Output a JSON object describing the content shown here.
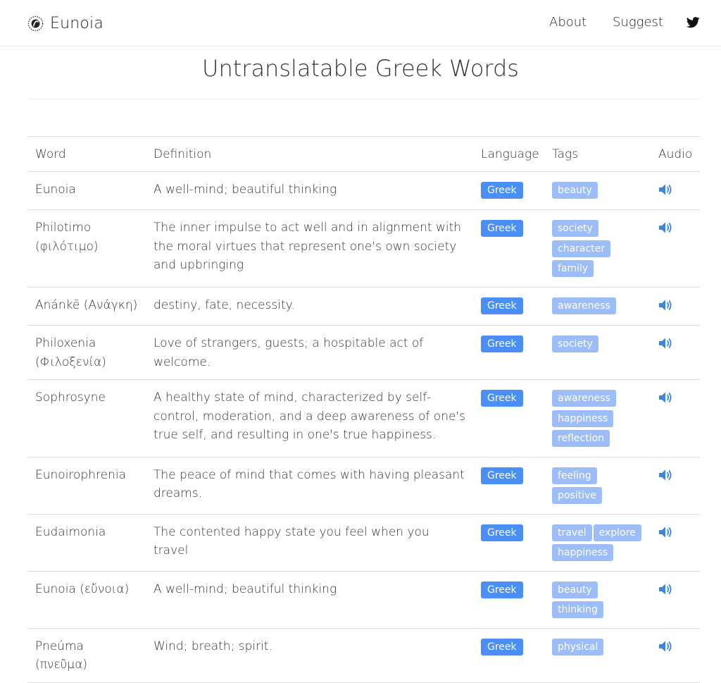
{
  "brand": {
    "name": "Eunoia"
  },
  "nav": {
    "about": "About",
    "suggest": "Suggest"
  },
  "page": {
    "title": "Untranslatable Greek Words"
  },
  "table": {
    "headers": [
      "Word",
      "Definition",
      "Language",
      "Tags",
      "Audio"
    ],
    "rows": [
      {
        "word": "Eunoia",
        "definition": "A well-mind; beautiful thinking",
        "language": "Greek",
        "tags": [
          "beauty"
        ]
      },
      {
        "word": "Philotimo (φιλότιμο)",
        "definition": "The inner impulse to act well and in alignment with the moral virtues that represent one's own society and upbringing",
        "language": "Greek",
        "tags": [
          "society",
          "character",
          "family"
        ]
      },
      {
        "word": "Anánkē (Ανάγκη)",
        "definition": "destiny, fate, necessity.",
        "language": "Greek",
        "tags": [
          "awareness"
        ]
      },
      {
        "word": "Philoxenia (Φιλοξενία)",
        "definition": "Love of strangers, guests; a hospitable act of welcome.",
        "language": "Greek",
        "tags": [
          "society"
        ]
      },
      {
        "word": "Sophrosyne",
        "definition": "A healthy state of mind, characterized by self-control, moderation, and a deep awareness of one's true self, and resulting in one's true happiness.",
        "language": "Greek",
        "tags": [
          "awareness",
          "happiness",
          "reflection"
        ]
      },
      {
        "word": "Eunoirophrenia",
        "definition": "The peace of mind that comes with having pleasant dreams.",
        "language": "Greek",
        "tags": [
          "feeling",
          "positive"
        ]
      },
      {
        "word": "Eudaimonia",
        "definition": "The contented happy state you feel when you travel",
        "language": "Greek",
        "tags": [
          "travel",
          "explore",
          "happiness"
        ]
      },
      {
        "word": "Eunoia (εὔνοια)",
        "definition": "A well-mind; beautiful thinking",
        "language": "Greek",
        "tags": [
          "beauty",
          "thinking"
        ]
      },
      {
        "word": "Pneúma (πνεῦμα)",
        "definition": "Wind; breath; spirit.",
        "language": "Greek",
        "tags": [
          "physical"
        ]
      }
    ]
  },
  "icons": {
    "logo": "eunoia-logo-icon",
    "social": "twitter-icon",
    "audio": "speaker-icon"
  },
  "colors": {
    "language_badge": "#4a8ff5",
    "tag": "#9cbdf8",
    "audio_icon": "#3f86d8"
  }
}
